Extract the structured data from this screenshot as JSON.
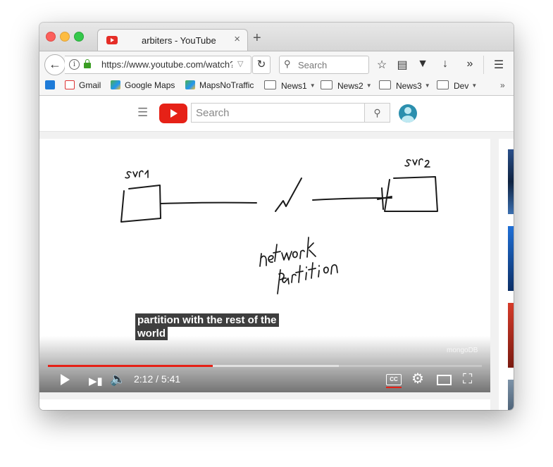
{
  "browser": {
    "tab_title": "arbiters - YouTube",
    "tab_close": "×",
    "new_tab": "+",
    "url": "https://www.youtube.com/watch?",
    "search_placeholder": "Search",
    "bookmarks": [
      {
        "label": "Gmail",
        "icon": "gmail-icon"
      },
      {
        "label": "Google Maps",
        "icon": "maps-icon"
      },
      {
        "label": "MapsNoTraffic",
        "icon": "maps-icon"
      },
      {
        "label": "News1",
        "icon": "folder-icon"
      },
      {
        "label": "News2",
        "icon": "folder-icon"
      },
      {
        "label": "News3",
        "icon": "folder-icon"
      },
      {
        "label": "Dev",
        "icon": "folder-icon"
      }
    ]
  },
  "youtube": {
    "search_placeholder": "Search"
  },
  "player": {
    "caption_line1": "partition with the rest of the",
    "caption_line2": "world",
    "watermark": "mongoDB",
    "time": "2:12 / 5:41",
    "progress_played_fraction": 0.38,
    "progress_buffered_fraction": 0.67,
    "accent_color": "#e62117"
  },
  "whiteboard": {
    "label_left": "svr1",
    "label_right": "svr2",
    "label_center": "network partition"
  }
}
